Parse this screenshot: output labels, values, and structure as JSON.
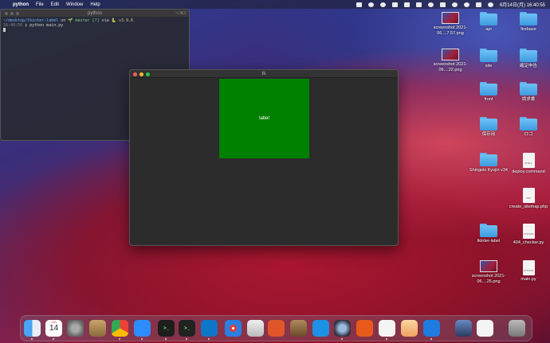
{
  "menubar": {
    "app_name": "python",
    "menus": [
      "File",
      "Edit",
      "Window",
      "Help"
    ],
    "clock": "6月14日(月) 16:40:55"
  },
  "terminal": {
    "title": "python",
    "shortcut": "⌥⌘2",
    "lines": {
      "path": "~/desktop/tkinter-label",
      "on": " on ",
      "branch": "🌱 master [?]",
      "via": " via ",
      "version": "🐍 v3.9.6",
      "time": "16:40:50",
      "prompt": " ❯ python main.py"
    }
  },
  "tk_window": {
    "title": "tk",
    "label_text": "label",
    "label_color": "#008000"
  },
  "desktop_icons": [
    {
      "name": "screenshot 2021-06....7.57.png",
      "kind": "thumb"
    },
    {
      "name": "api",
      "kind": "folder"
    },
    {
      "name": "firebase",
      "kind": "folder"
    },
    {
      "name": "screenshot 2021-06....22.png",
      "kind": "thumb"
    },
    {
      "name": "site",
      "kind": "folder"
    },
    {
      "name": "確定申告",
      "kind": "folder"
    },
    {
      "name": "front",
      "kind": "folder"
    },
    {
      "name": "請求書",
      "kind": "folder"
    },
    {
      "name": "保存用",
      "kind": "folder"
    },
    {
      "name": "ロゴ",
      "kind": "folder"
    },
    {
      "name": "Shingeki Kyojin v34",
      "kind": "folder"
    },
    {
      "name": "deploy.command",
      "kind": "doc",
      "badge": "SHELL"
    },
    {
      "name": "create_sitemap.php",
      "kind": "doc",
      "badge": "PHP"
    },
    {
      "name": "tkinter-label",
      "kind": "folder"
    },
    {
      "name": "404_checker.py",
      "kind": "doc",
      "badge": "PYTHON"
    },
    {
      "name": "screenshot 2021-06....26.png",
      "kind": "thumb"
    },
    {
      "name": "main.py",
      "kind": "doc",
      "badge": "PYTHON"
    }
  ],
  "dock": {
    "calendar_day": "14",
    "calendar_month": "JUN",
    "apps": [
      "finder-icon",
      "calendar-icon",
      "system-preferences-icon",
      "photo-app-icon",
      "chrome-icon",
      "zoom-icon",
      "terminal-icon",
      "iterm-icon",
      "vscode-icon",
      "safari-icon",
      "db-tool-icon",
      "activity-icon",
      "archive-icon",
      "docker-icon",
      "network-icon",
      "filezilla-icon",
      "app-icon",
      "preview-icon",
      "infinity-icon",
      "screenshot-icon",
      "document-icon",
      "trash-icon"
    ]
  }
}
